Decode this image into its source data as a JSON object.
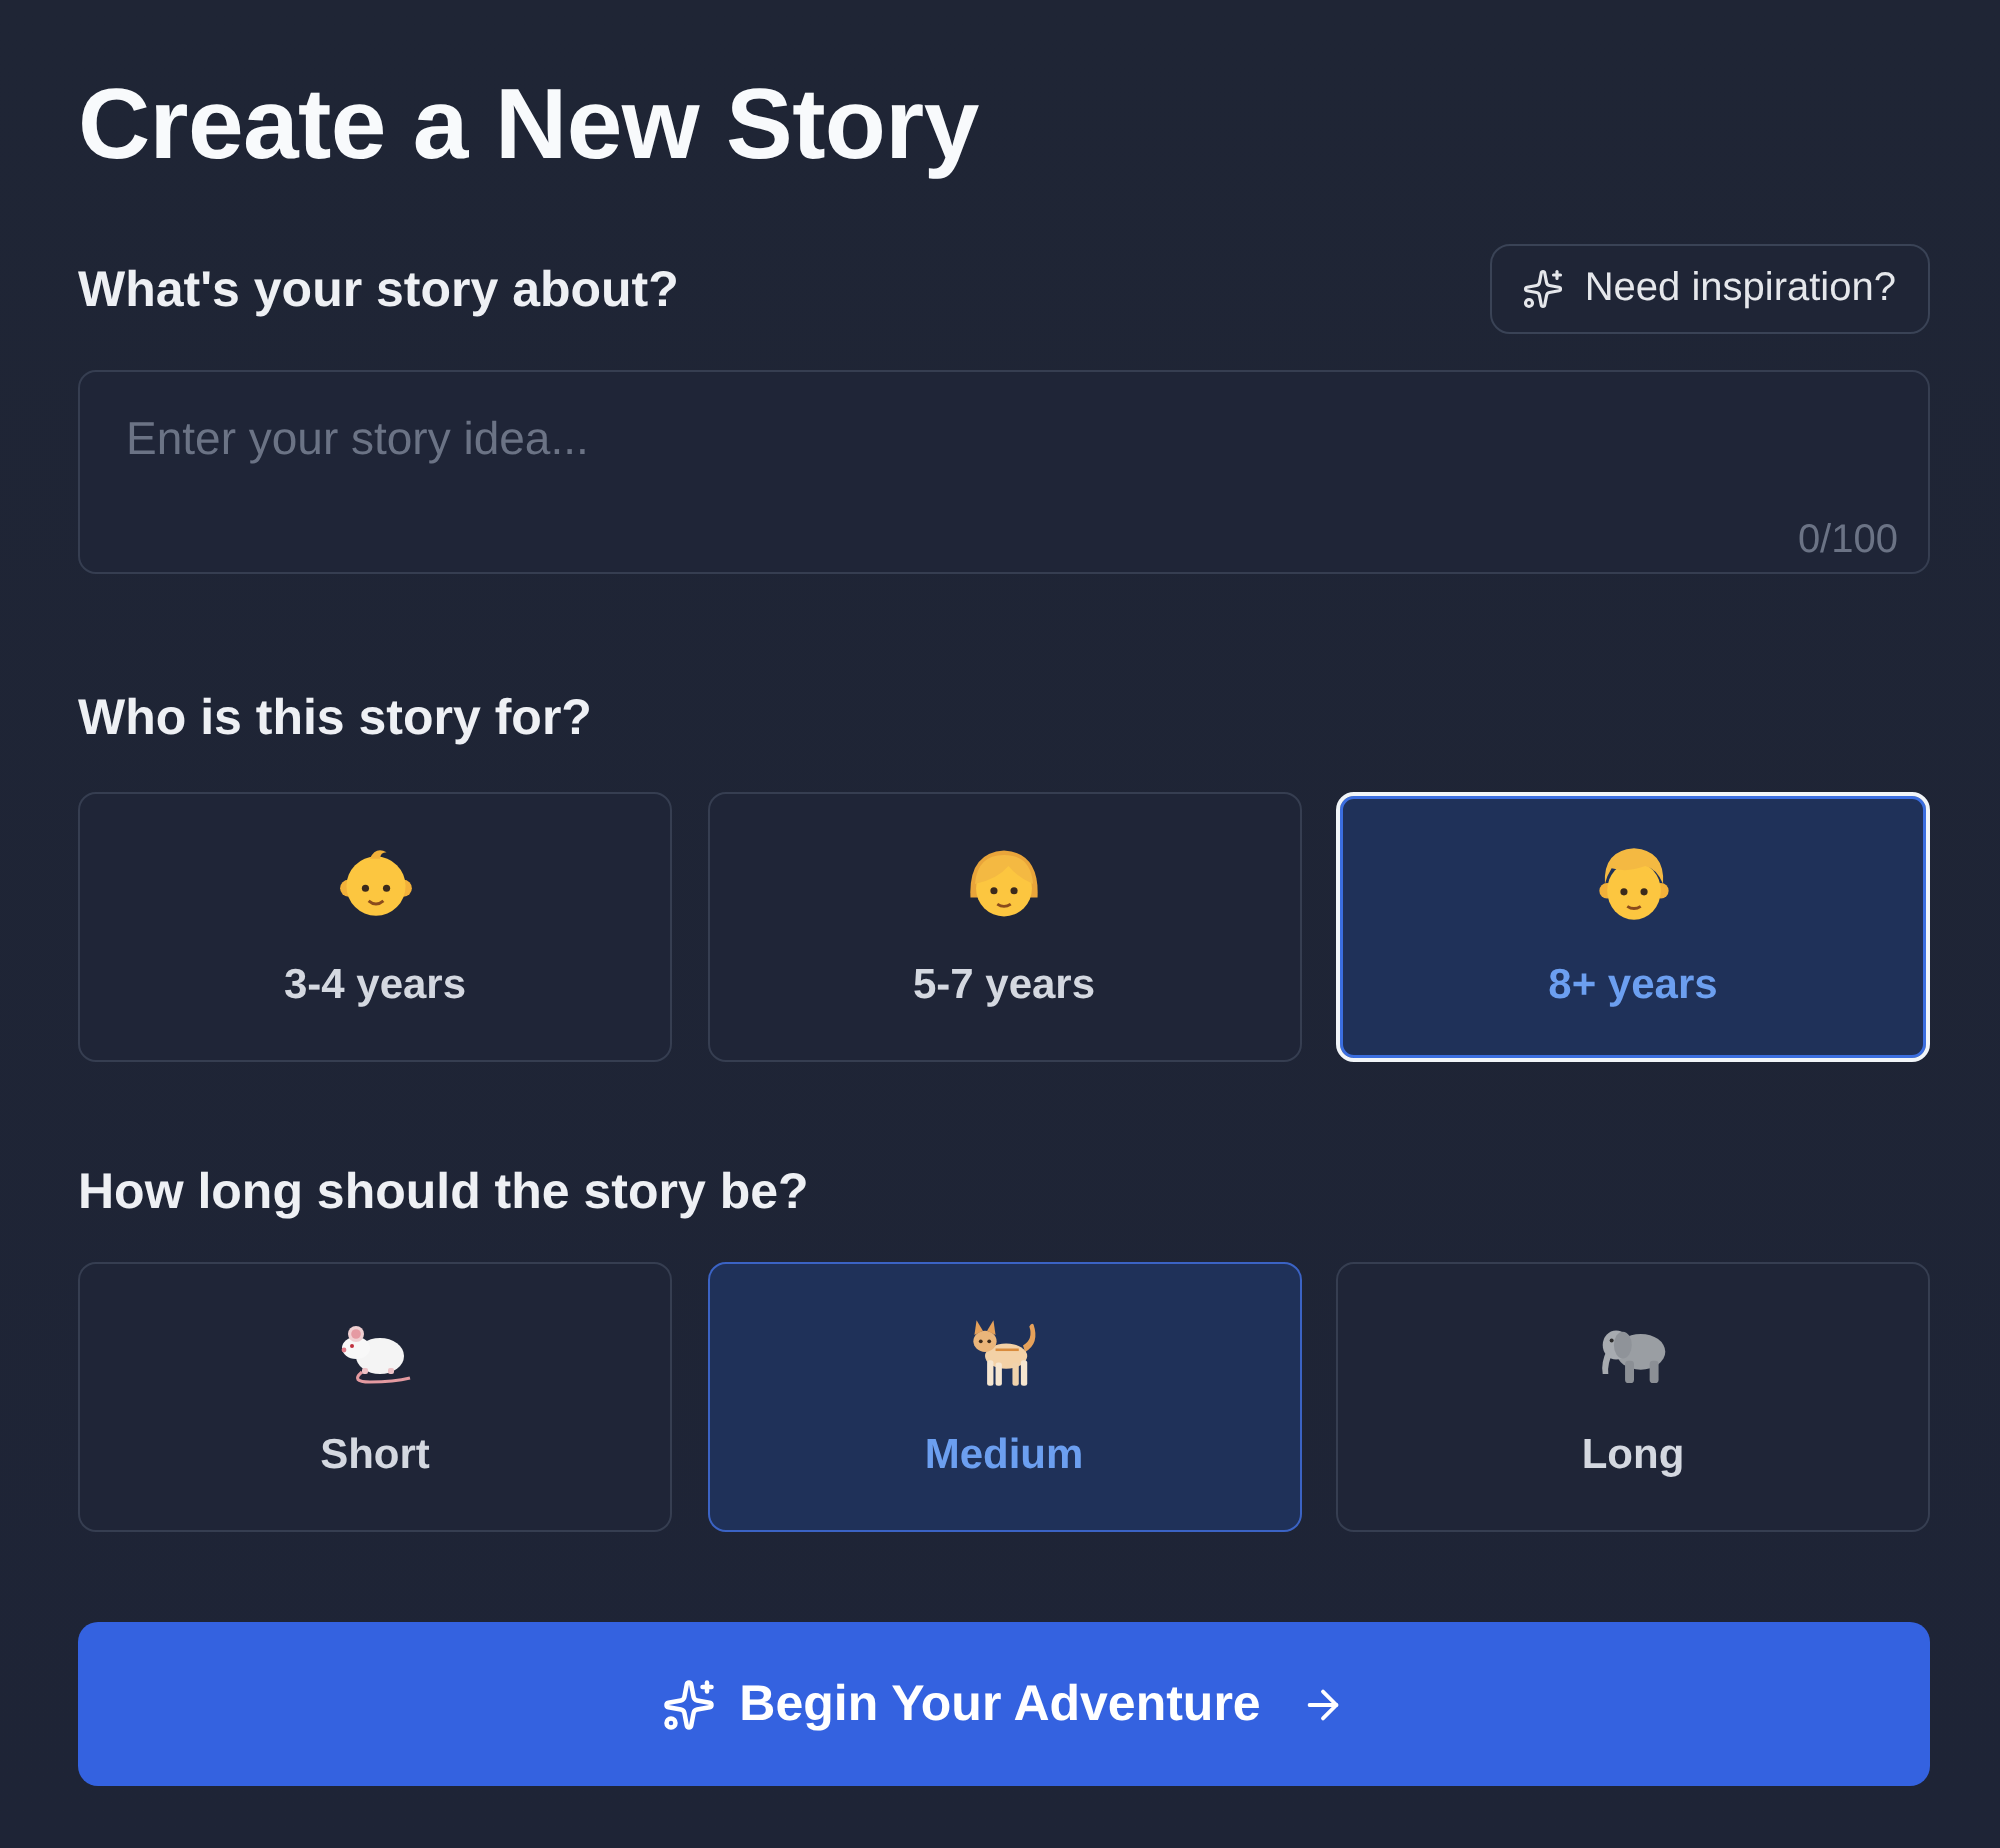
{
  "title": "Create a New Story",
  "story_prompt": {
    "label": "What's your story about?",
    "inspiration_button": "Need inspiration?",
    "placeholder": "Enter your story idea...",
    "character_count": "0/100"
  },
  "audience": {
    "label": "Who is this story for?",
    "options": [
      {
        "label": "3-4 years",
        "selected": false,
        "focused": false
      },
      {
        "label": "5-7 years",
        "selected": false,
        "focused": false
      },
      {
        "label": "8+ years",
        "selected": true,
        "focused": true
      }
    ]
  },
  "length": {
    "label": "How long should the story be?",
    "options": [
      {
        "label": "Short",
        "selected": false
      },
      {
        "label": "Medium",
        "selected": true
      },
      {
        "label": "Long",
        "selected": false
      }
    ]
  },
  "submit_button": "Begin Your Adventure"
}
